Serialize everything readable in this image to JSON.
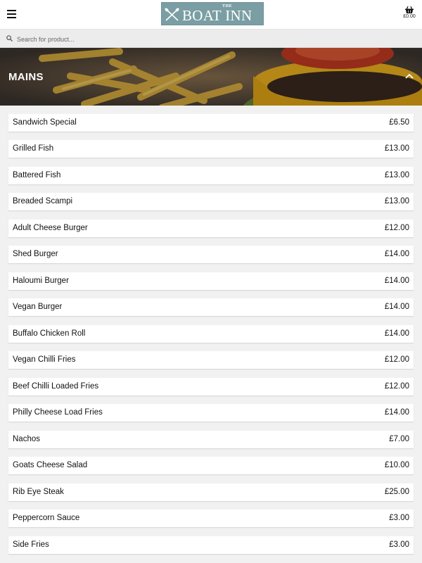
{
  "header": {
    "logo_small": "THE",
    "logo_name": "BOAT INN",
    "cart_total": "£0.00"
  },
  "search": {
    "placeholder": "Search for product..."
  },
  "section": {
    "title": "MAINS"
  },
  "items": [
    {
      "name": "Sandwich Special",
      "price": "£6.50"
    },
    {
      "name": "Grilled Fish",
      "price": "£13.00"
    },
    {
      "name": "Battered Fish",
      "price": "£13.00"
    },
    {
      "name": "Breaded Scampi",
      "price": "£13.00"
    },
    {
      "name": "Adult Cheese Burger",
      "price": "£12.00"
    },
    {
      "name": "Shed Burger",
      "price": "£14.00"
    },
    {
      "name": "Haloumi Burger",
      "price": "£14.00"
    },
    {
      "name": "Vegan Burger",
      "price": "£14.00"
    },
    {
      "name": "Buffalo Chicken Roll",
      "price": "£14.00"
    },
    {
      "name": "Vegan Chilli Fries",
      "price": "£12.00"
    },
    {
      "name": "Beef Chilli Loaded Fries",
      "price": "£12.00"
    },
    {
      "name": "Philly Cheese Load Fries",
      "price": "£14.00"
    },
    {
      "name": "Nachos",
      "price": "£7.00"
    },
    {
      "name": "Goats Cheese Salad",
      "price": "£10.00"
    },
    {
      "name": "Rib Eye Steak",
      "price": "£25.00"
    },
    {
      "name": "Peppercorn Sauce",
      "price": "£3.00"
    },
    {
      "name": "Side Fries",
      "price": "£3.00"
    }
  ],
  "colors": {
    "logo_bg": "#7a9ea3",
    "page_bg": "#f1f1f1"
  },
  "icons": {
    "menu": "hamburger-icon",
    "cart": "basket-icon",
    "search": "search-icon",
    "collapse": "chevron-up-icon"
  }
}
